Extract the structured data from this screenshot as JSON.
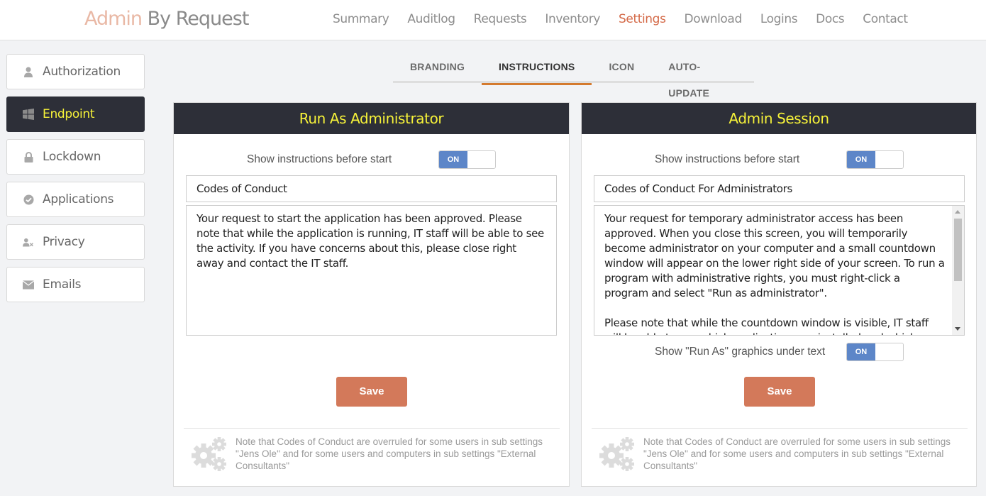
{
  "header": {
    "logo_part1": "Admin",
    "logo_part2": " By Request",
    "nav": [
      {
        "label": "Summary",
        "active": false
      },
      {
        "label": "Auditlog",
        "active": false
      },
      {
        "label": "Requests",
        "active": false
      },
      {
        "label": "Inventory",
        "active": false
      },
      {
        "label": "Settings",
        "active": true
      },
      {
        "label": "Download",
        "active": false
      },
      {
        "label": "Logins",
        "active": false
      },
      {
        "label": "Docs",
        "active": false
      },
      {
        "label": "Contact",
        "active": false
      }
    ]
  },
  "sidebar": {
    "items": [
      {
        "label": "Authorization",
        "icon": "user-icon",
        "active": false
      },
      {
        "label": "Endpoint",
        "icon": "windows-icon",
        "active": true
      },
      {
        "label": "Lockdown",
        "icon": "lock-icon",
        "active": false
      },
      {
        "label": "Applications",
        "icon": "check-circle-icon",
        "active": false
      },
      {
        "label": "Privacy",
        "icon": "user-times-icon",
        "active": false
      },
      {
        "label": "Emails",
        "icon": "envelope-icon",
        "active": false
      }
    ]
  },
  "tabs": [
    {
      "label": "BRANDING",
      "active": false
    },
    {
      "label": "INSTRUCTIONS",
      "active": true
    },
    {
      "label": "ICON",
      "active": false
    },
    {
      "label": "AUTO-UPDATE",
      "active": false
    }
  ],
  "panels": {
    "run_as_admin": {
      "title": "Run As Administrator",
      "show_instructions_label": "Show instructions before start",
      "show_instructions_value": "ON",
      "heading_value": "Codes of Conduct",
      "body_value": "Your request to start the application has been approved. Please note that while the application is running, IT staff will be able to see the activity. If you have concerns about this, please close right away and contact the IT staff.",
      "save_label": "Save",
      "note": "Note that Codes of Conduct are overruled for some users in sub settings \"Jens Ole\" and for some users and computers in sub settings \"External Consultants\""
    },
    "admin_session": {
      "title": "Admin Session",
      "show_instructions_label": "Show instructions before start",
      "show_instructions_value": "ON",
      "heading_value": "Codes of Conduct For Administrators",
      "body_value": "Your request for temporary administrator access has been approved. When you close this screen, you will temporarily become administrator on your computer and a small countdown window will appear on the lower right side of your screen. To run a program with administrative rights, you must right-click a program and select \"Run as administrator\".\n\nPlease note that while the countdown window is visible, IT staff will be able to see which applications are installed and which",
      "show_graphics_label": "Show \"Run As\" graphics under text",
      "show_graphics_value": "ON",
      "save_label": "Save",
      "note": "Note that Codes of Conduct are overruled for some users in sub settings \"Jens Ole\" and for some users and computers in sub settings \"External Consultants\""
    }
  },
  "colors": {
    "accent_nav": "#d46a48",
    "tab_underline": "#d47a2e",
    "panel_header_bg": "#2d2f38",
    "panel_header_text": "#f6f239",
    "toggle_on": "#5d86c8",
    "save_button": "#d3795a"
  }
}
